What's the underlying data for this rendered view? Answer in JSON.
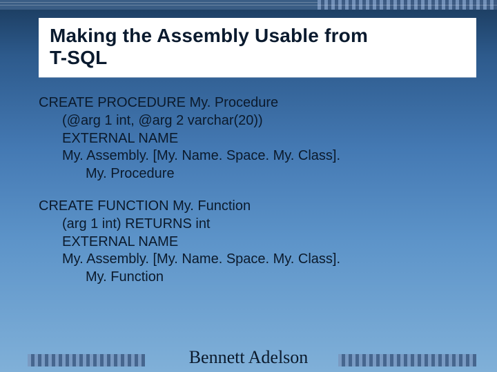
{
  "title_line1": "Making the Assembly Usable from",
  "title_line2": "T-SQL",
  "block1": {
    "l0": "CREATE PROCEDURE My. Procedure",
    "l1": "(@arg 1 int, @arg 2 varchar(20))",
    "l2": "EXTERNAL NAME",
    "l3": "My. Assembly. [My. Name. Space. My. Class].",
    "l4": "My. Procedure"
  },
  "block2": {
    "l0": "CREATE FUNCTION My. Function",
    "l1": "(arg 1 int) RETURNS int",
    "l2": "EXTERNAL NAME",
    "l3": "My. Assembly. [My. Name. Space. My. Class].",
    "l4": "My. Function"
  },
  "footer_name": "Bennett Adelson"
}
